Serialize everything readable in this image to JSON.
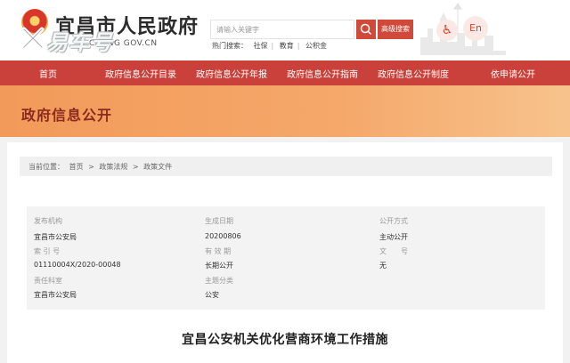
{
  "header": {
    "site_title": "宜昌市人民政府",
    "site_sub": "CHANG GOV.CN",
    "watermark": "易车号",
    "search_placeholder": "请输入关键字",
    "advanced_search": "高级搜索",
    "hot_label": "热门搜索：",
    "hot_items": [
      "社保",
      "教育",
      "公积金"
    ],
    "lang_label": "En"
  },
  "nav": {
    "items": [
      "首页",
      "政府信息公开目录",
      "政府信息公开年报",
      "政府信息公开指南",
      "政府信息公开制度",
      "依申请公开"
    ]
  },
  "banner": {
    "title": "政府信息公开"
  },
  "breadcrumb": {
    "label": "当前位置：",
    "items": [
      "首页",
      "政策法规",
      "政策文件"
    ],
    "separator": ">"
  },
  "meta": {
    "publisher_label": "发布机构",
    "publisher": "宜昌市公安局",
    "date_label": "生成日期",
    "date": "20200806",
    "method_label": "公开方式",
    "method": "主动公开",
    "index_label": "索 引 号",
    "index": "01110004X/2020-00048",
    "validity_label": "有 效 期",
    "validity": "长期公开",
    "docno_label": "文　　号",
    "docno": "无",
    "dept_label": "责任科室",
    "dept": "宜昌市公安局",
    "category_label": "主题分类",
    "category": "公安"
  },
  "document": {
    "title": "宜昌公安机关优化营商环境工作措施"
  },
  "colors": {
    "nav_red": "#c9413a",
    "banner_orange": "#f29a5a",
    "accent": "#cf4a3a"
  }
}
